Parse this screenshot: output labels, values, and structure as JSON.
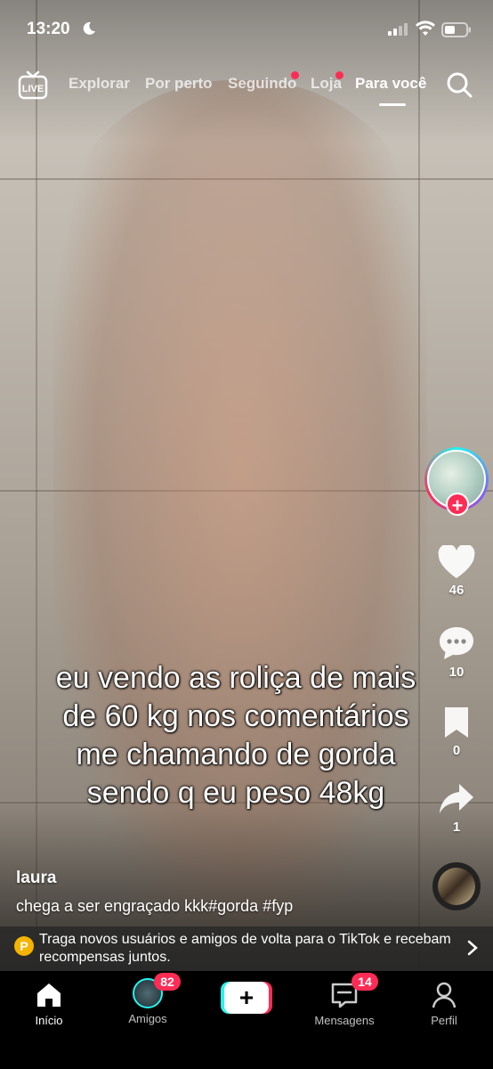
{
  "status_bar": {
    "time": "13:20"
  },
  "top_nav": {
    "live_label": "LIVE",
    "tabs": [
      {
        "label": "Explorar",
        "active": false,
        "dot": false
      },
      {
        "label": "Por perto",
        "active": false,
        "dot": false
      },
      {
        "label": "Seguindo",
        "active": false,
        "dot": true
      },
      {
        "label": "Loja",
        "active": false,
        "dot": true
      },
      {
        "label": "Para você",
        "active": true,
        "dot": false
      }
    ]
  },
  "video": {
    "overlay_caption_lines": [
      "eu vendo as roliça de mais",
      "de 60 kg nos comentários",
      "me chamando de gorda",
      "sendo q eu peso 48kg"
    ]
  },
  "rail": {
    "likes": "46",
    "comments": "10",
    "saves": "0",
    "shares": "1"
  },
  "post": {
    "author": "laura",
    "description": "chega a ser engraçado kkk#gorda #fyp"
  },
  "promo": {
    "badge": "P",
    "text": "Traga novos usuários e amigos de volta para o TikTok e recebam recompensas juntos."
  },
  "bottom_nav": {
    "home": "Início",
    "friends": "Amigos",
    "friends_badge": "82",
    "inbox": "Mensagens",
    "inbox_badge": "14",
    "profile": "Perfil"
  },
  "colors": {
    "accent_red": "#fe2c55",
    "accent_cyan": "#25f4ee",
    "promo_badge": "#f4b400"
  }
}
